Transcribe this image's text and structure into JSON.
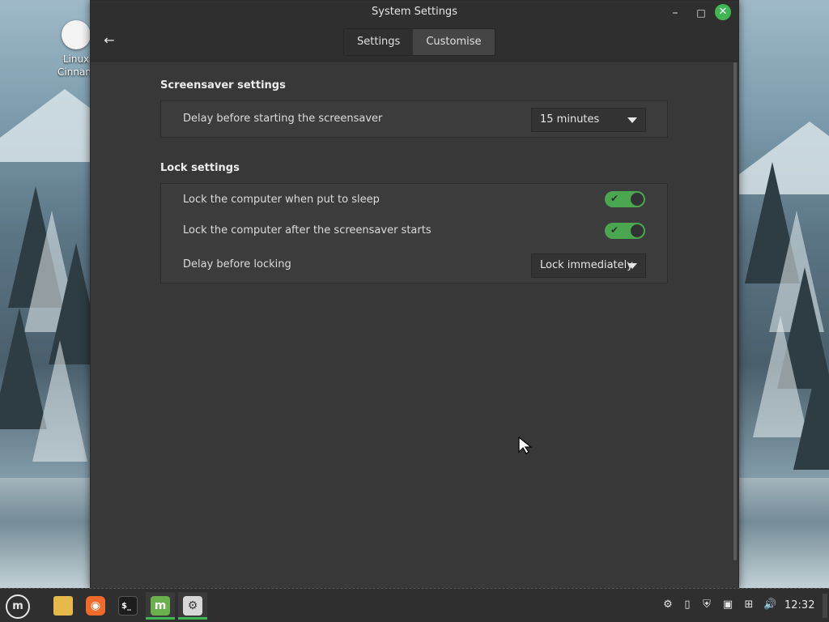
{
  "desktop": {
    "icon_label_line1": "Linux",
    "icon_label_line2": "Cinnam"
  },
  "window": {
    "title": "System Settings",
    "controls": {
      "minimize": "–",
      "maximize": "□",
      "close": "✕",
      "back": "←"
    },
    "tabs": [
      {
        "label": "Settings",
        "active": false
      },
      {
        "label": "Customise",
        "active": true
      }
    ]
  },
  "screensaver": {
    "heading": "Screensaver settings",
    "delay_label": "Delay before starting the screensaver",
    "delay_value": "15 minutes"
  },
  "lock": {
    "heading": "Lock settings",
    "sleep_label": "Lock the computer when put to sleep",
    "sleep_enabled": true,
    "screensaver_label": "Lock the computer after the screensaver starts",
    "screensaver_enabled": true,
    "delay_label": "Delay before locking",
    "delay_value": "Lock immediately"
  },
  "taskbar": {
    "apps": [
      {
        "name": "menu",
        "icon": "mint-menu-icon"
      },
      {
        "name": "files",
        "icon": "folder-icon"
      },
      {
        "name": "firefox",
        "icon": "firefox-icon"
      },
      {
        "name": "terminal",
        "icon": "terminal-icon"
      },
      {
        "name": "mintupdate",
        "icon": "mint-icon"
      },
      {
        "name": "system-settings",
        "icon": "settings-icon",
        "active": true
      }
    ],
    "clock": "12:32"
  },
  "colors": {
    "accent": "#3fb553",
    "window_bg": "#383838",
    "titlebar_bg": "#2f2f2f"
  }
}
